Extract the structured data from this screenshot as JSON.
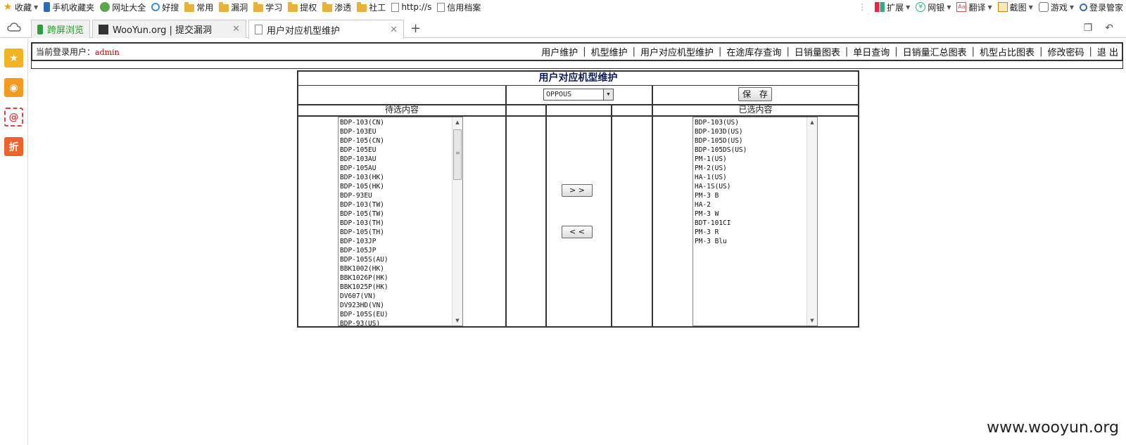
{
  "bookmarks": {
    "left": [
      {
        "icon": "star-icon",
        "label": "收藏",
        "caret": true
      },
      {
        "icon": "phone-icon",
        "label": "手机收藏夹"
      },
      {
        "icon": "globe-icon",
        "label": "网址大全"
      },
      {
        "icon": "search-icon",
        "label": "好搜"
      },
      {
        "icon": "folder-icon",
        "label": "常用"
      },
      {
        "icon": "folder-icon",
        "label": "漏洞"
      },
      {
        "icon": "folder-icon",
        "label": "学习"
      },
      {
        "icon": "folder-icon",
        "label": "提权"
      },
      {
        "icon": "folder-icon",
        "label": "渗透"
      },
      {
        "icon": "folder-icon",
        "label": "社工"
      },
      {
        "icon": "page-icon",
        "label": "http://s"
      },
      {
        "icon": "page-icon",
        "label": "信用档案"
      }
    ],
    "right": [
      {
        "icon": "grid-icon",
        "label": "扩展"
      },
      {
        "icon": "money-icon",
        "label": "网银"
      },
      {
        "icon": "translate-icon",
        "label": "翻译"
      },
      {
        "icon": "screenshot-icon",
        "label": "截图"
      },
      {
        "icon": "game-icon",
        "label": "游戏"
      },
      {
        "icon": "key-icon",
        "label": "登录管家"
      }
    ]
  },
  "tabs": [
    {
      "label": "跨屏浏览"
    },
    {
      "label": "WooYun.org | 提交漏洞"
    },
    {
      "label": "用户对应机型维护"
    }
  ],
  "header": {
    "login_label": "当前登录用户：",
    "login_user": "admin",
    "nav": [
      "用户维护",
      "机型维护",
      "用户对应机型维护",
      "在途库存查询",
      "日销量图表",
      "单日查询",
      "日销量汇总图表",
      "机型占比图表",
      "修改密码",
      "退 出"
    ]
  },
  "panel": {
    "title": "用户对应机型维护",
    "select_value": "OPPOUS",
    "save_label": "保 存",
    "available_label": "待选内容",
    "selected_label": "已选内容",
    "move_right_label": "> >",
    "move_left_label": "< <",
    "available": [
      "BDP-103(CN)",
      "BDP-103EU",
      "BDP-105(CN)",
      "BDP-105EU",
      "BDP-103AU",
      "BDP-105AU",
      "BDP-103(HK)",
      "BDP-105(HK)",
      "BDP-93EU",
      "BDP-103(TW)",
      "BDP-105(TW)",
      "BDP-103(TH)",
      "BDP-105(TH)",
      "BDP-103JP",
      "BDP-105JP",
      "BDP-105S(AU)",
      "BBK1002(HK)",
      "BBK1026P(HK)",
      "BBK1025P(HK)",
      "DV607(VN)",
      "DV923HD(VN)",
      "BDP-105S(EU)",
      "BDP-93(US)"
    ],
    "selected": [
      "BDP-103(US)",
      "BDP-103D(US)",
      "BDP-105D(US)",
      "BDP-105DS(US)",
      "PM-1(US)",
      "PM-2(US)",
      "HA-1(US)",
      "HA-1S(US)",
      "PM-3 B",
      "HA-2",
      "PM-3 W",
      "BDT-101CI",
      "PM-3 R",
      "PM-3 Blu"
    ]
  },
  "watermark": "www.wooyun.org"
}
